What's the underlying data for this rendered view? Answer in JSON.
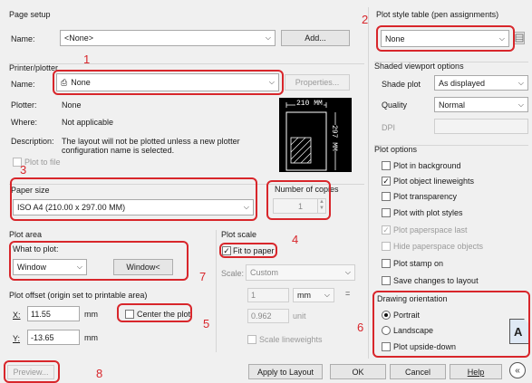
{
  "page_setup": {
    "group_title": "Page setup",
    "name_label": "Name:",
    "name_value": "<None>",
    "add_button": "Add..."
  },
  "printer": {
    "group_title": "Printer/plotter",
    "name_label": "Name:",
    "name_value": "None",
    "properties_button": "Properties...",
    "plotter_label": "Plotter:",
    "plotter_value": "None",
    "where_label": "Where:",
    "where_value": "Not applicable",
    "description_label": "Description:",
    "description_line1": "The layout will not be plotted unless a new plotter",
    "description_line2": "configuration name is selected.",
    "plot_to_file": "Plot to file",
    "preview_width": "210 MM",
    "preview_height": "297 MM"
  },
  "paper": {
    "group_title": "Paper size",
    "value": "ISO A4 (210.00 x 297.00 MM)",
    "copies_label": "Number of copies",
    "copies_value": "1"
  },
  "plot_area": {
    "group_title": "Plot area",
    "what_label": "What to plot:",
    "what_value": "Window",
    "window_button": "Window<"
  },
  "plot_offset": {
    "group_title": "Plot offset (origin set to printable area)",
    "x_label": "X:",
    "x_value": "11.55",
    "x_unit": "mm",
    "y_label": "Y:",
    "y_value": "-13.65",
    "y_unit": "mm",
    "center_label": "Center the plot"
  },
  "plot_scale": {
    "group_title": "Plot scale",
    "fit_label": "Fit to paper",
    "scale_label": "Scale:",
    "scale_value": "Custom",
    "value1": "1",
    "unit_value": "mm",
    "equals": "=",
    "value2": "0.962",
    "unit_label": "unit",
    "lineweights_label": "Scale lineweights"
  },
  "plot_style": {
    "group_title": "Plot style table (pen assignments)",
    "value": "None"
  },
  "shaded": {
    "group_title": "Shaded viewport options",
    "shade_label": "Shade plot",
    "shade_value": "As displayed",
    "quality_label": "Quality",
    "quality_value": "Normal",
    "dpi_label": "DPI"
  },
  "plot_options": {
    "group_title": "Plot options",
    "items": [
      {
        "label": "Plot in background",
        "checked": "",
        "disabled": false
      },
      {
        "label": "Plot object lineweights",
        "checked": "✓",
        "disabled": false
      },
      {
        "label": "Plot transparency",
        "checked": "",
        "disabled": false
      },
      {
        "label": "Plot with plot styles",
        "checked": "",
        "disabled": false
      },
      {
        "label": "Plot paperspace last",
        "checked": "✓",
        "disabled": true
      },
      {
        "label": "Hide paperspace objects",
        "checked": "",
        "disabled": true
      },
      {
        "label": "Plot stamp on",
        "checked": "",
        "disabled": false
      },
      {
        "label": "Save changes to layout",
        "checked": "",
        "disabled": false
      }
    ]
  },
  "orientation": {
    "group_title": "Drawing orientation",
    "portrait": "Portrait",
    "landscape": "Landscape",
    "upside_down": "Plot upside-down",
    "page_icon_letter": "A"
  },
  "footer": {
    "preview": "Preview...",
    "apply": "Apply to Layout",
    "ok": "OK",
    "cancel": "Cancel",
    "help": "Help"
  },
  "callouts": [
    "1",
    "2",
    "3",
    "4",
    "5",
    "6",
    "7",
    "8"
  ],
  "colors": {
    "callout_red": "#d8262b",
    "dialog_bg": "#f0f0f0"
  }
}
